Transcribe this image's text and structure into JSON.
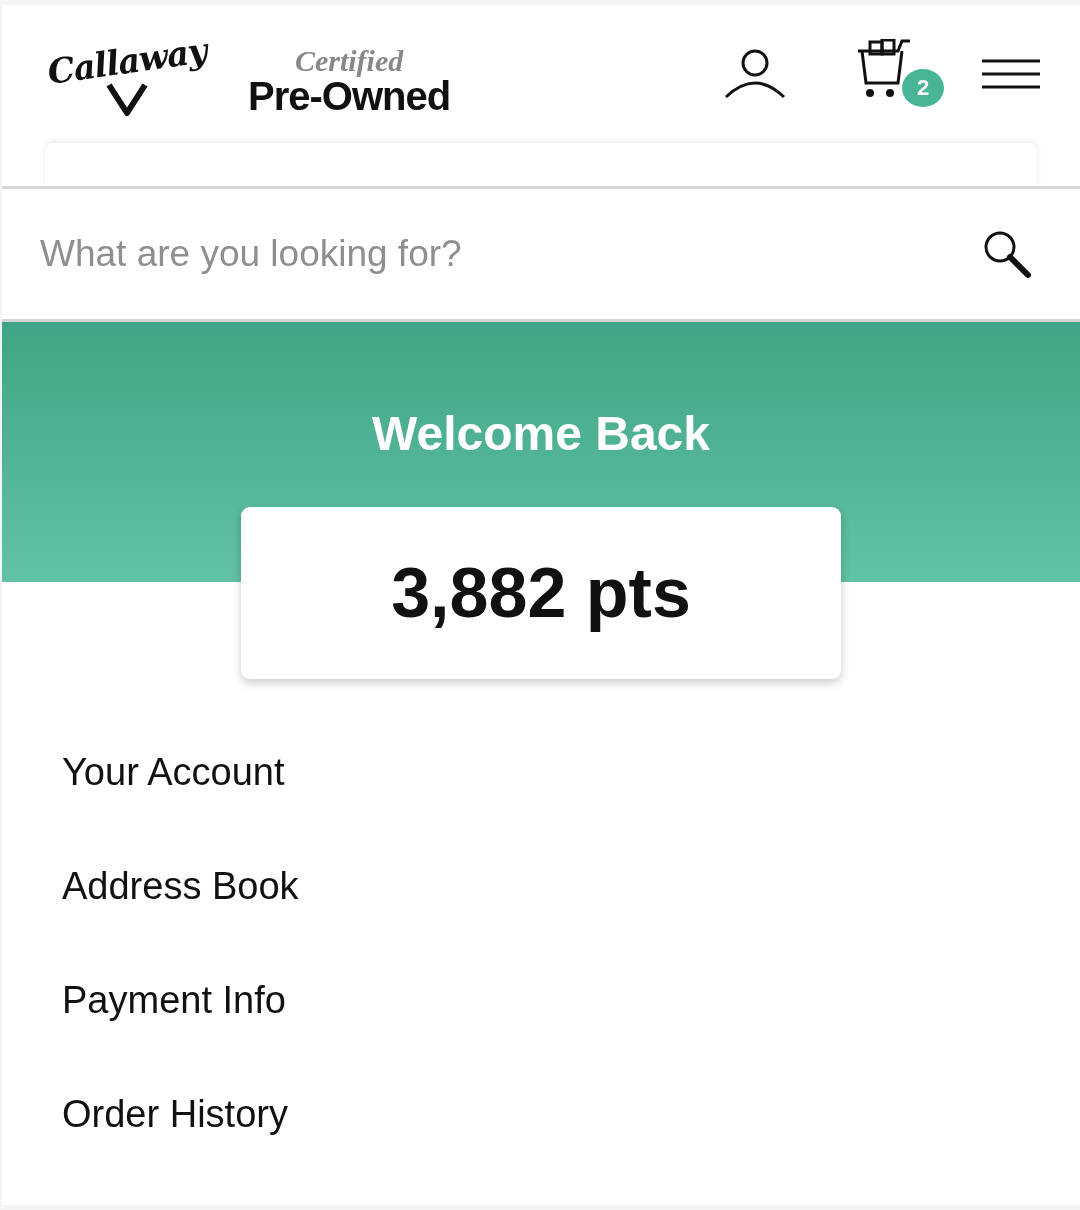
{
  "header": {
    "brand": "Callaway",
    "certified": "Certified",
    "pre_owned": "Pre-Owned",
    "cart_count": "2"
  },
  "search": {
    "placeholder": "What are you looking for?"
  },
  "banner": {
    "title": "Welcome Back",
    "points": "3,882 pts"
  },
  "menu": [
    {
      "label": "Your Account"
    },
    {
      "label": "Address Book"
    },
    {
      "label": "Payment Info"
    },
    {
      "label": "Order History"
    }
  ]
}
